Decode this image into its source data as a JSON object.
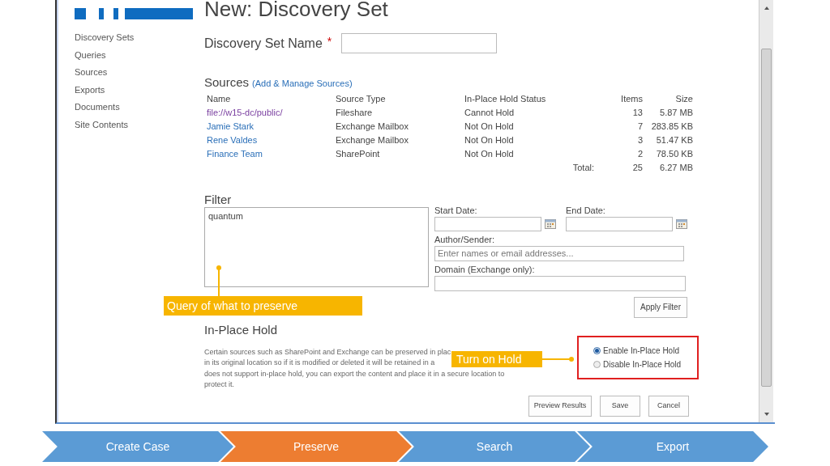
{
  "page": {
    "title": "New: Discovery Set"
  },
  "sidebar": {
    "items": [
      {
        "label": "Discovery Sets"
      },
      {
        "label": "Queries"
      },
      {
        "label": "Sources"
      },
      {
        "label": "Exports"
      },
      {
        "label": "Documents"
      },
      {
        "label": "Site Contents"
      }
    ]
  },
  "name_field": {
    "label": "Discovery Set Name",
    "required_mark": "*"
  },
  "sources": {
    "title": "Sources",
    "link": "(Add & Manage Sources)",
    "columns": [
      "Name",
      "Source Type",
      "In-Place Hold Status",
      "Items",
      "Size"
    ],
    "rows": [
      {
        "name": "file://w15-dc/public/",
        "visited": true,
        "type": "Fileshare",
        "status": "Cannot Hold",
        "items": "13",
        "size": "5.87 MB"
      },
      {
        "name": "Jamie Stark",
        "visited": false,
        "type": "Exchange Mailbox",
        "status": "Not On Hold",
        "items": "7",
        "size": "283.85 KB"
      },
      {
        "name": "Rene Valdes",
        "visited": false,
        "type": "Exchange Mailbox",
        "status": "Not On Hold",
        "items": "3",
        "size": "51.47 KB"
      },
      {
        "name": "Finance Team",
        "visited": false,
        "type": "SharePoint",
        "status": "Not On Hold",
        "items": "2",
        "size": "78.50 KB"
      }
    ],
    "total": {
      "label": "Total:",
      "items": "25",
      "size": "6.27 MB"
    }
  },
  "filter": {
    "title": "Filter",
    "query": "quantum",
    "start_date_label": "Start Date:",
    "end_date_label": "End Date:",
    "author_label": "Author/Sender:",
    "author_placeholder": "Enter names or email addresses...",
    "domain_label": "Domain (Exchange only):",
    "apply_button": "Apply Filter"
  },
  "hold": {
    "title": "In-Place Hold",
    "description_lines": [
      "Certain sources such as SharePoint and Exchange can be preserved in plac",
      "in its original location so if it is modified or deleted it will be retained in a",
      "does not support in-place hold, you can export the content and place it in a secure location to",
      "protect it."
    ],
    "options": [
      {
        "label": "Enable In-Place Hold",
        "selected": true
      },
      {
        "label": "Disable In-Place Hold",
        "selected": false
      }
    ]
  },
  "buttons": [
    "Preview Results",
    "Save",
    "Cancel"
  ],
  "callouts": [
    {
      "text": "Query of what to preserve"
    },
    {
      "text": "Turn on Hold"
    }
  ],
  "steps": [
    {
      "label": "Create Case",
      "selected": false
    },
    {
      "label": "Preserve",
      "selected": true
    },
    {
      "label": "Search",
      "selected": false
    },
    {
      "label": "Export",
      "selected": false
    }
  ]
}
